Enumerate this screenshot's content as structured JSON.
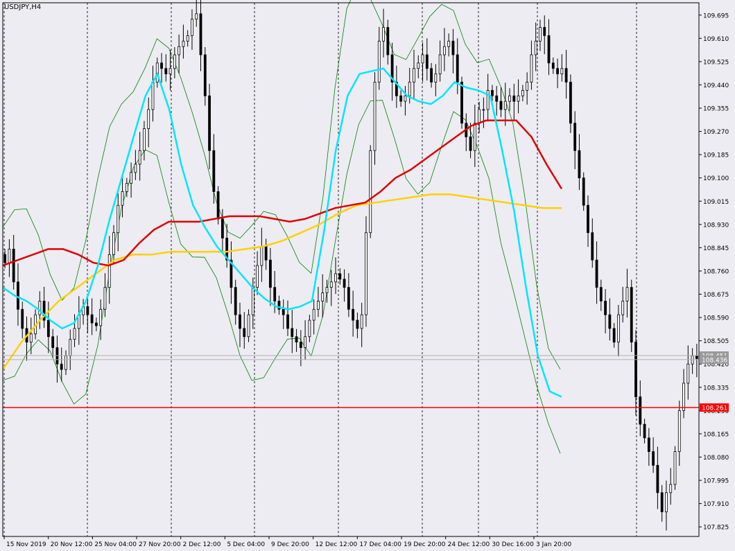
{
  "symbol_label": "USDJPY,H4",
  "colors": {
    "background": "#ececf2",
    "axis": "#000000",
    "candle": "#000000",
    "bollinger": "#008000",
    "ma_fast": "#00e5ff",
    "ma_mid": "#e00000",
    "ma_slow": "#ffd000",
    "hline": "#ff0000",
    "price_marker": "#9a9a9a"
  },
  "price_axis": {
    "ticks": [
      "109.695",
      "109.610",
      "109.525",
      "109.440",
      "109.355",
      "109.270",
      "109.185",
      "109.100",
      "109.015",
      "108.930",
      "108.845",
      "108.760",
      "108.675",
      "108.590",
      "108.505",
      "108.420",
      "108.335",
      "108.250",
      "108.165",
      "108.080",
      "107.995",
      "107.910",
      "107.825"
    ],
    "range": [
      107.79,
      109.74
    ]
  },
  "time_axis": {
    "labels": [
      "15 Nov 2019",
      "20 Nov 12:00",
      "25 Nov 04:00",
      "27 Nov 20:00",
      "2 Dec 12:00",
      "5 Dec 04:00",
      "9 Dec 20:00",
      "12 Dec 12:00",
      "17 Dec 04:00",
      "19 Dec 20:00",
      "24 Dec 12:00",
      "30 Dec 16:00",
      "3 Jan 20:00"
    ]
  },
  "horizontal_line": {
    "label": "108.261",
    "value": 108.261
  },
  "current_price": {
    "bid": "108.451",
    "ask": "108.436",
    "bid_value": 108.451,
    "ask_value": 108.436
  },
  "chart_data": {
    "type": "candlestick",
    "count": 160,
    "close": [
      108.79,
      108.84,
      108.72,
      108.62,
      108.55,
      108.5,
      108.53,
      108.6,
      108.65,
      108.58,
      108.52,
      108.48,
      108.42,
      108.4,
      108.45,
      108.51,
      108.55,
      108.6,
      108.63,
      108.6,
      108.57,
      108.56,
      108.62,
      108.7,
      108.82,
      108.9,
      109.0,
      109.05,
      109.08,
      109.12,
      109.15,
      109.2,
      109.28,
      109.35,
      109.45,
      109.52,
      109.5,
      109.48,
      109.5,
      109.55,
      109.58,
      109.6,
      109.62,
      109.68,
      109.7,
      109.55,
      109.4,
      109.2,
      109.05,
      108.95,
      108.88,
      108.8,
      108.7,
      108.6,
      108.55,
      108.52,
      108.6,
      108.7,
      108.78,
      108.85,
      108.8,
      108.7,
      108.65,
      108.62,
      108.6,
      108.55,
      108.52,
      108.5,
      108.48,
      108.52,
      108.58,
      108.62,
      108.65,
      108.68,
      108.7,
      108.72,
      108.75,
      108.73,
      108.7,
      108.62,
      108.58,
      108.55,
      108.6,
      108.9,
      109.2,
      109.45,
      109.6,
      109.65,
      109.55,
      109.45,
      109.4,
      109.38,
      109.4,
      109.45,
      109.5,
      109.52,
      109.55,
      109.5,
      109.45,
      109.48,
      109.55,
      109.58,
      109.6,
      109.55,
      109.45,
      109.3,
      109.25,
      109.2,
      109.3,
      109.35,
      109.35,
      109.42,
      109.4,
      109.38,
      109.35,
      109.38,
      109.4,
      109.38,
      109.4,
      109.42,
      109.45,
      109.55,
      109.6,
      109.65,
      109.62,
      109.52,
      109.5,
      109.48,
      109.5,
      109.45,
      109.3,
      109.2,
      109.1,
      109.0,
      108.9,
      108.8,
      108.7,
      108.65,
      108.6,
      108.55,
      108.5,
      108.6,
      108.65,
      108.7,
      108.5,
      108.3,
      108.2,
      108.15,
      108.1,
      108.05,
      107.95,
      107.88,
      107.95,
      107.98,
      108.1,
      108.25,
      108.35,
      108.42,
      108.45,
      108.44
    ],
    "indicators": {
      "bollinger_period": "20",
      "ma_fast_period": "20",
      "ma_mid_period": "100",
      "ma_slow_period": "200",
      "ma_fast": [
        108.7,
        108.67,
        108.65,
        108.62,
        108.58,
        108.55,
        108.57,
        108.65,
        108.78,
        108.95,
        109.1,
        109.25,
        109.4,
        109.48,
        109.35,
        109.15,
        109.0,
        108.92,
        108.85,
        108.8,
        108.75,
        108.7,
        108.66,
        108.63,
        108.62,
        108.63,
        108.65,
        108.9,
        109.2,
        109.4,
        109.48,
        109.49,
        109.5,
        109.45,
        109.4,
        109.38,
        109.37,
        109.4,
        109.45,
        109.43,
        109.42,
        109.4,
        109.2,
        108.98,
        108.7,
        108.45,
        108.32,
        108.3
      ],
      "ma_mid": [
        108.78,
        108.8,
        108.82,
        108.84,
        108.84,
        108.82,
        108.79,
        108.78,
        108.8,
        108.86,
        108.91,
        108.94,
        108.94,
        108.94,
        108.95,
        108.96,
        108.96,
        108.96,
        108.95,
        108.94,
        108.95,
        108.97,
        108.99,
        109.0,
        109.01,
        109.05,
        109.1,
        109.13,
        109.17,
        109.21,
        109.25,
        109.29,
        109.31,
        109.31,
        109.31,
        109.25,
        109.15,
        109.06
      ],
      "ma_slow": [
        108.4,
        108.5,
        108.58,
        108.65,
        108.7,
        108.75,
        108.8,
        108.82,
        108.82,
        108.83,
        108.83,
        108.83,
        108.83,
        108.84,
        108.85,
        108.87,
        108.9,
        108.93,
        108.97,
        109.0,
        109.01,
        109.02,
        109.03,
        109.04,
        109.04,
        109.03,
        109.02,
        109.01,
        109.0,
        108.99,
        108.99
      ]
    }
  }
}
